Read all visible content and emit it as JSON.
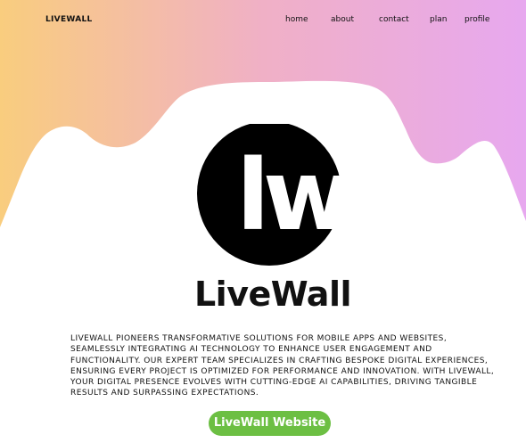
{
  "colors": {
    "gradient_left": "#f9cd7e",
    "gradient_mid": "#f0b0c6",
    "gradient_right": "#e7a8ef",
    "text": "#111111",
    "button_bg": "#6cbf43",
    "button_text": "#ffffff"
  },
  "nav": {
    "brand": "LIVEWALL",
    "links": [
      "home",
      "about",
      "contact",
      "plan",
      "profile"
    ]
  },
  "logo": {
    "icon": "livewall-lw-logo",
    "letters": "lw"
  },
  "hero": {
    "title": "LiveWall",
    "description": "LiveWall pioneers transformative solutions for mobile apps and websites, seamlessly integrating AI technology to enhance user engagement and functionality. Our expert team specializes in crafting bespoke digital experiences, ensuring every project is optimized for performance and innovation. With LiveWall, your digital presence evolves with cutting-edge AI capabilities, driving tangible results and surpassing expectations.",
    "cta_label": "LiveWall Website"
  }
}
